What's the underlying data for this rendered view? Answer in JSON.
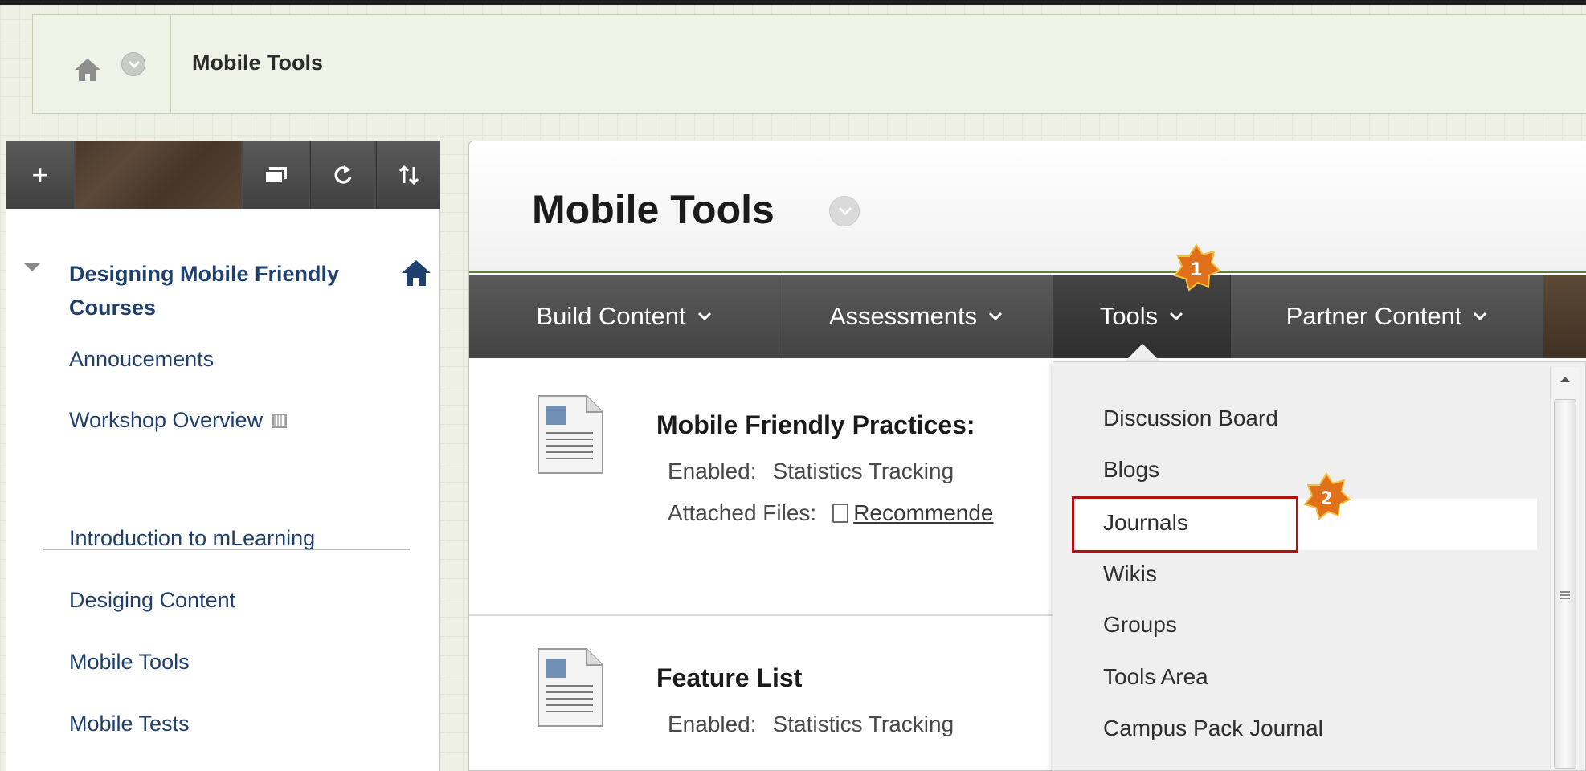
{
  "breadcrumb": {
    "title": "Mobile Tools"
  },
  "course_menu": {
    "toolbar": {
      "add_label": "+"
    },
    "course_title": "Designing Mobile Friendly Courses",
    "items": [
      {
        "label": "Annoucements"
      },
      {
        "label": "Workshop Overview"
      },
      {
        "label": "Introduction to mLearning"
      },
      {
        "label": "Desiging Content"
      },
      {
        "label": "Mobile Tools"
      },
      {
        "label": "Mobile Tests"
      }
    ]
  },
  "content": {
    "title": "Mobile Tools",
    "action_bar": [
      {
        "label": "Build Content"
      },
      {
        "label": "Assessments"
      },
      {
        "label": "Tools"
      },
      {
        "label": "Partner Content"
      }
    ],
    "items": [
      {
        "title": "Mobile Friendly Practices:",
        "enabled_label": "Enabled:",
        "enabled_value": "Statistics Tracking",
        "attached_label": "Attached Files:",
        "attached_file": "Recommende"
      },
      {
        "title": "Feature List",
        "enabled_label": "Enabled:",
        "enabled_value": "Statistics Tracking"
      }
    ]
  },
  "tools_dropdown": {
    "items": [
      {
        "label": "Discussion Board"
      },
      {
        "label": "Blogs"
      },
      {
        "label": "Journals"
      },
      {
        "label": "Wikis"
      },
      {
        "label": "Groups"
      },
      {
        "label": "Tools Area"
      },
      {
        "label": "Campus Pack Journal"
      }
    ],
    "highlighted": "Journals"
  },
  "callouts": {
    "step1": "1",
    "step2": "2"
  },
  "colors": {
    "link_blue": "#1f3f6d",
    "header_green": "#5e8234",
    "action_bar": "#4a4a4a",
    "callout_red": "#b01212",
    "badge_orange": "#e0701a"
  },
  "icons": {
    "breadcrumb_home": "home-icon",
    "breadcrumb_menu": "chevron-down-icon",
    "toolbar": [
      "plus-icon",
      "display-icon",
      "refresh-icon",
      "sort-icon"
    ],
    "course_home": "home-icon",
    "content_item": "document-icon"
  }
}
